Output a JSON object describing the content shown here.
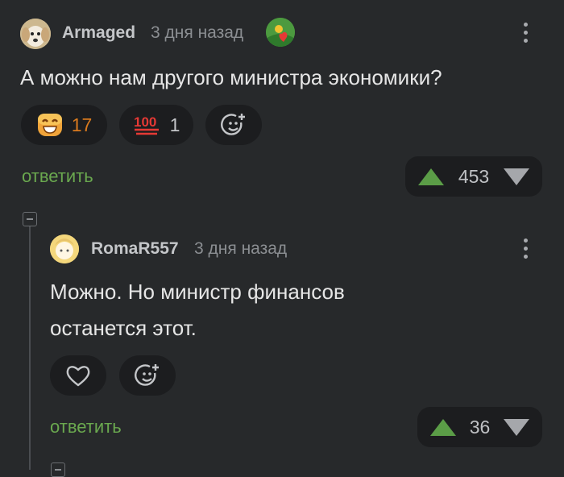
{
  "comment1": {
    "username": "Armaged",
    "time": "3 дня назад",
    "text": "А можно нам другого министра экономики?",
    "reactions": [
      {
        "icon": "smiling-face-icon",
        "count": "17",
        "color": "#d97a1e"
      },
      {
        "icon": "hundred-points-icon",
        "count": "1",
        "color": "#c4c6c9"
      }
    ],
    "reply_label": "ответить",
    "score": "453"
  },
  "comment2": {
    "username": "RomaR557",
    "time": "3 дня назад",
    "text_line1": "Можно. Но министр финансов",
    "text_line2": "останется этот.",
    "reply_label": "ответить",
    "score": "36"
  },
  "colors": {
    "background": "#27292b",
    "pill_bg": "#1c1d1f",
    "reply_green": "#6aa84f",
    "upvote_green": "#5b9d47"
  }
}
